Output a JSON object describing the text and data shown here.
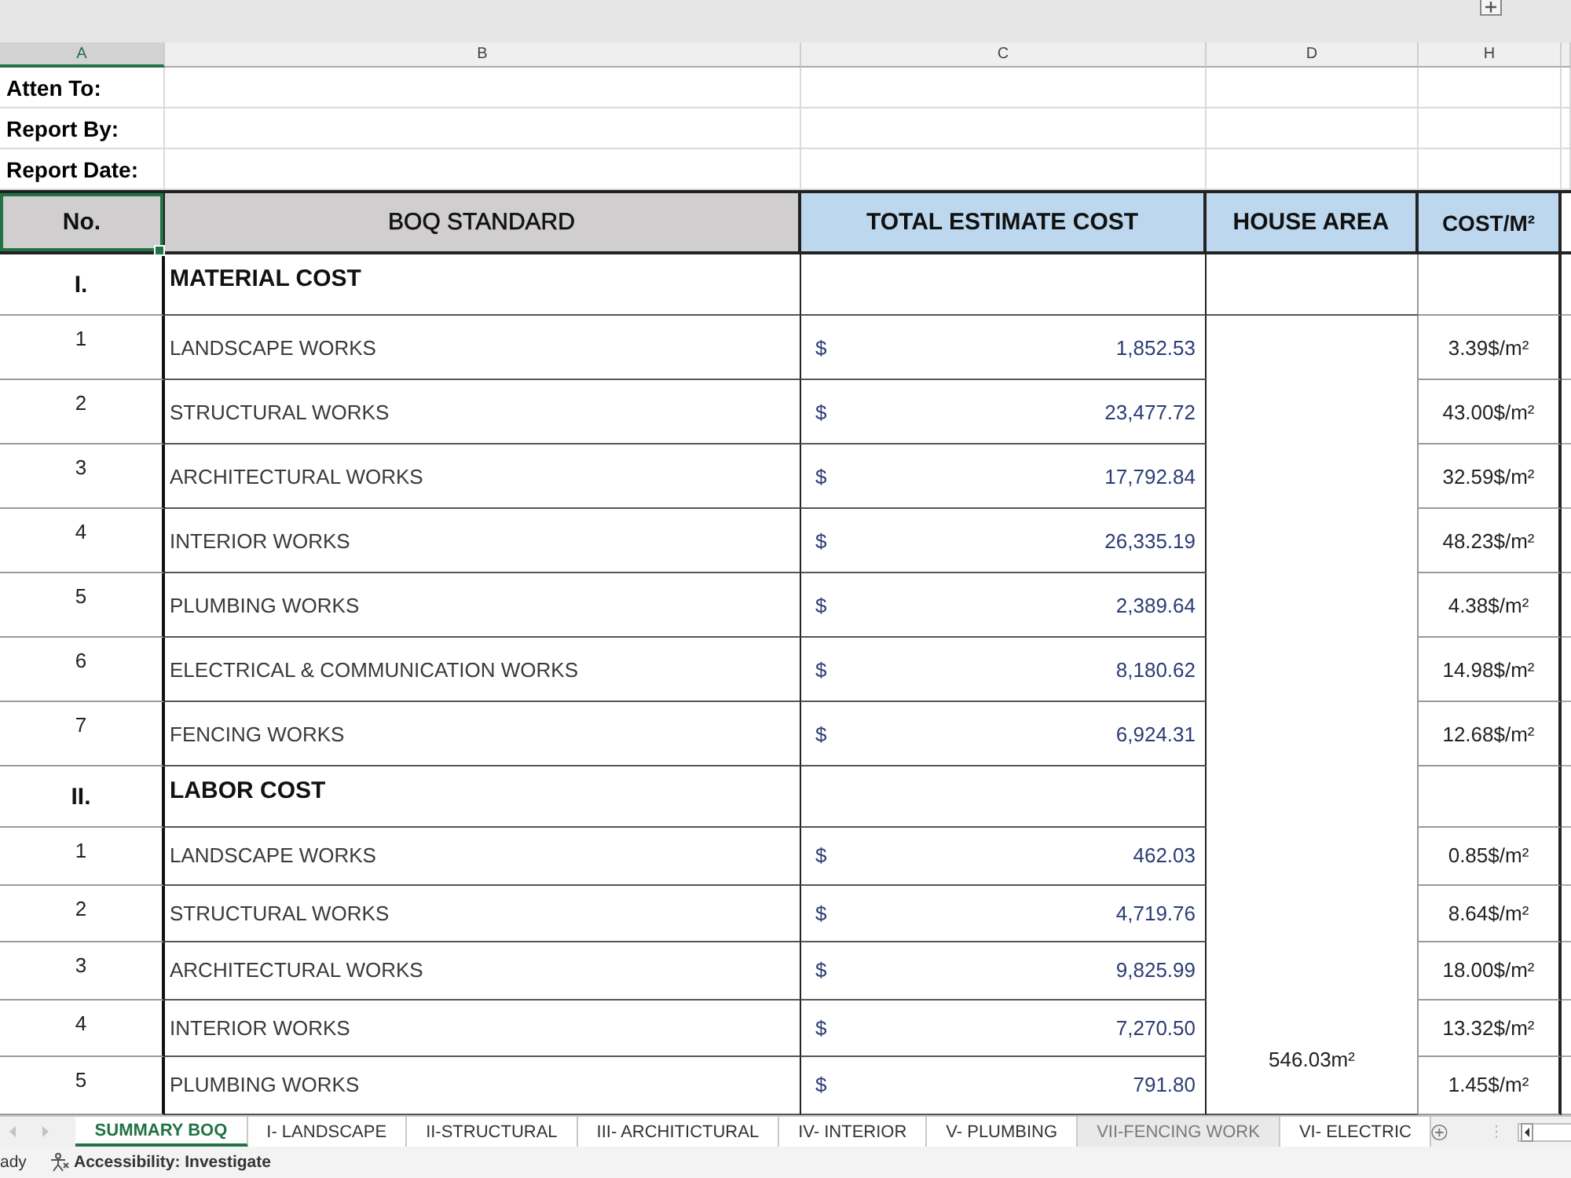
{
  "column_headers": [
    {
      "label": "A",
      "selected": true
    },
    {
      "label": "B",
      "selected": false
    },
    {
      "label": "C",
      "selected": false
    },
    {
      "label": "D",
      "selected": false
    },
    {
      "label": "H",
      "selected": false
    }
  ],
  "info_rows": [
    {
      "label": "Atten To:"
    },
    {
      "label": "Report By:"
    },
    {
      "label": "Report Date:"
    }
  ],
  "table": {
    "columns": [
      {
        "label": "No.",
        "color": "#d0cece",
        "selected": true
      },
      {
        "label": "BOQ STANDARD",
        "color": "#d0cece",
        "selected": false
      },
      {
        "label": "TOTAL ESTIMATE COST",
        "color": "#bdd7ee",
        "selected": false
      },
      {
        "label": "HOUSE AREA",
        "color": "#bdd7ee",
        "selected": false
      },
      {
        "label": "COST/M²",
        "color": "#bdd7ee",
        "selected": false
      }
    ],
    "sections": [
      {
        "number": "I.",
        "title": "MATERIAL COST",
        "rows": [
          {
            "no": "1",
            "item": "LANDSCAPE WORKS",
            "currency": "$",
            "amount": "1,852.53",
            "cost_per_m2": "3.39$/m²"
          },
          {
            "no": "2",
            "item": "STRUCTURAL WORKS",
            "currency": "$",
            "amount": "23,477.72",
            "cost_per_m2": "43.00$/m²"
          },
          {
            "no": "3",
            "item": "ARCHITECTURAL WORKS",
            "currency": "$",
            "amount": "17,792.84",
            "cost_per_m2": "32.59$/m²"
          },
          {
            "no": "4",
            "item": "INTERIOR WORKS",
            "currency": "$",
            "amount": "26,335.19",
            "cost_per_m2": "48.23$/m²"
          },
          {
            "no": "5",
            "item": "PLUMBING WORKS",
            "currency": "$",
            "amount": "2,389.64",
            "cost_per_m2": "4.38$/m²"
          },
          {
            "no": "6",
            "item": "ELECTRICAL & COMMUNICATION WORKS",
            "currency": "$",
            "amount": "8,180.62",
            "cost_per_m2": "14.98$/m²"
          },
          {
            "no": "7",
            "item": "FENCING WORKS",
            "currency": "$",
            "amount": "6,924.31",
            "cost_per_m2": "12.68$/m²"
          }
        ]
      },
      {
        "number": "II.",
        "title": "LABOR COST",
        "rows": [
          {
            "no": "1",
            "item": "LANDSCAPE WORKS",
            "currency": "$",
            "amount": "462.03",
            "cost_per_m2": "0.85$/m²"
          },
          {
            "no": "2",
            "item": "STRUCTURAL WORKS",
            "currency": "$",
            "amount": "4,719.76",
            "cost_per_m2": "8.64$/m²"
          },
          {
            "no": "3",
            "item": "ARCHITECTURAL WORKS",
            "currency": "$",
            "amount": "9,825.99",
            "cost_per_m2": "18.00$/m²"
          },
          {
            "no": "4",
            "item": "INTERIOR WORKS",
            "currency": "$",
            "amount": "7,270.50",
            "cost_per_m2": "13.32$/m²"
          },
          {
            "no": "5",
            "item": "PLUMBING WORKS",
            "currency": "$",
            "amount": "791.80",
            "cost_per_m2": "1.45$/m²"
          }
        ]
      }
    ],
    "house_area": "546.03m²"
  },
  "sheet_tabs": [
    {
      "label": "SUMMARY BOQ",
      "selected": true,
      "dimmed": false
    },
    {
      "label": "I- LANDSCAPE",
      "selected": false,
      "dimmed": false
    },
    {
      "label": "II-STRUCTURAL",
      "selected": false,
      "dimmed": false
    },
    {
      "label": "III- ARCHITICTURAL",
      "selected": false,
      "dimmed": false
    },
    {
      "label": "IV- INTERIOR",
      "selected": false,
      "dimmed": false
    },
    {
      "label": "V- PLUMBING",
      "selected": false,
      "dimmed": false
    },
    {
      "label": "VII-FENCING WORK",
      "selected": false,
      "dimmed": true
    },
    {
      "label": "VI- ELECTRIC",
      "selected": false,
      "dimmed": false
    }
  ],
  "status_bar": {
    "mode": "ady",
    "accessibility": "Accessibility: Investigate"
  }
}
